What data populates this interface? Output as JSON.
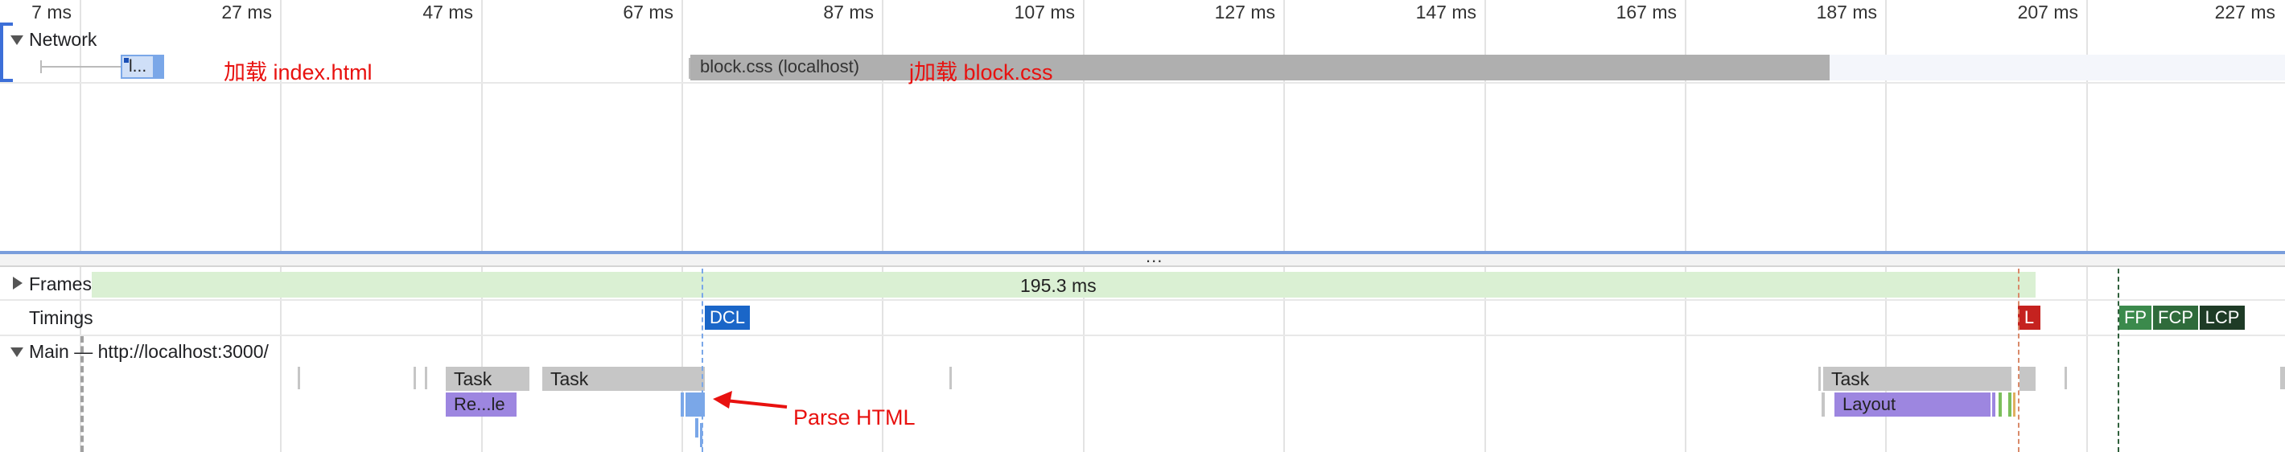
{
  "ruler": {
    "ticks": [
      {
        "label": "7 ms"
      },
      {
        "label": "27 ms"
      },
      {
        "label": "47 ms"
      },
      {
        "label": "67 ms"
      },
      {
        "label": "87 ms"
      },
      {
        "label": "107 ms"
      },
      {
        "label": "127 ms"
      },
      {
        "label": "147 ms"
      },
      {
        "label": "167 ms"
      },
      {
        "label": "187 ms"
      },
      {
        "label": "207 ms"
      },
      {
        "label": "227 ms"
      }
    ]
  },
  "network": {
    "title": "Network",
    "index_request_label": "l...",
    "block_request_label": "block.css (localhost)",
    "annotation_index": "加载 index.html",
    "annotation_block": "j加载 block.css"
  },
  "divider": {
    "handle": "..."
  },
  "frames": {
    "label": "Frames",
    "duration": "195.3 ms"
  },
  "timings": {
    "label": "Timings",
    "markers": [
      {
        "label": "DCL",
        "color": "#1a66c8"
      },
      {
        "label": "L",
        "color": "#c5221f"
      },
      {
        "label": "FP",
        "color": "#3b8a4c"
      },
      {
        "label": "FCP",
        "color": "#2f6b3b"
      },
      {
        "label": "LCP",
        "color": "#1e3b26"
      }
    ]
  },
  "main": {
    "label": "Main — http://localhost:3000/",
    "tasks": [
      "Task",
      "Task",
      "Task"
    ],
    "recalc_label": "Re...le",
    "layout_label": "Layout",
    "parse_annotation": "Parse HTML"
  },
  "colors": {
    "accent_blue": "#3c6fd8",
    "annotation_red": "#e8110f",
    "task_gray": "#c6c6c6",
    "rendering_purple": "#9d86e0",
    "scripting_blue": "#7aa7e8",
    "frames_green": "#daf0d3"
  }
}
